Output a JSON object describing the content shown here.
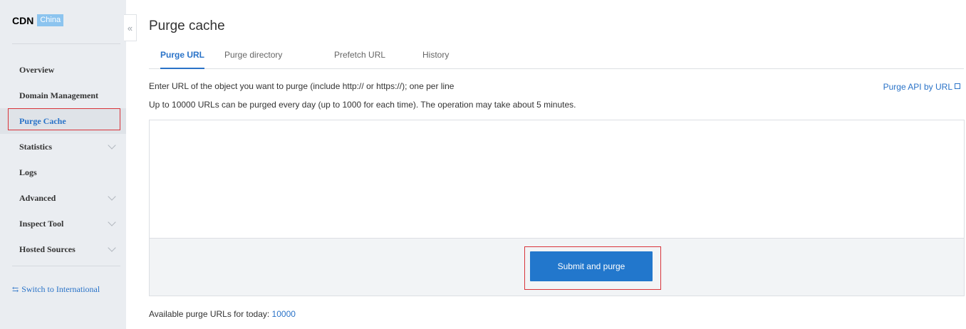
{
  "sidebar": {
    "brand_name": "CDN",
    "brand_badge": "China",
    "items": [
      {
        "label": "Overview",
        "has_submenu": false
      },
      {
        "label": "Domain Management",
        "has_submenu": false
      },
      {
        "label": "Purge Cache",
        "has_submenu": false,
        "active": true
      },
      {
        "label": "Statistics",
        "has_submenu": true
      },
      {
        "label": "Logs",
        "has_submenu": false
      },
      {
        "label": "Advanced",
        "has_submenu": true
      },
      {
        "label": "Inspect Tool",
        "has_submenu": true
      },
      {
        "label": "Hosted Sources",
        "has_submenu": true
      }
    ],
    "switch_label": "Switch to International",
    "collapse_glyph": "«"
  },
  "page": {
    "title": "Purge cache",
    "tabs": [
      {
        "label": "Purge URL",
        "active": true
      },
      {
        "label": "Purge directory",
        "active": false
      },
      {
        "label": "Prefetch URL",
        "active": false
      },
      {
        "label": "History",
        "active": false
      }
    ],
    "instruction_1": "Enter URL of the object you want to purge (include http:// or https://); one per line",
    "instruction_2": "Up to 10000 URLs can be purged every day (up to 1000 for each time). The operation may take about 5 minutes.",
    "api_link": "Purge API by URL",
    "textarea_value": "",
    "submit_label": "Submit and purge",
    "available_label": "Available purge URLs for today: ",
    "available_count": "10000"
  },
  "colors": {
    "accent": "#2a73c8",
    "button": "#2277cc",
    "highlight": "#d9343a",
    "sidebar_bg": "#eaedf1"
  }
}
